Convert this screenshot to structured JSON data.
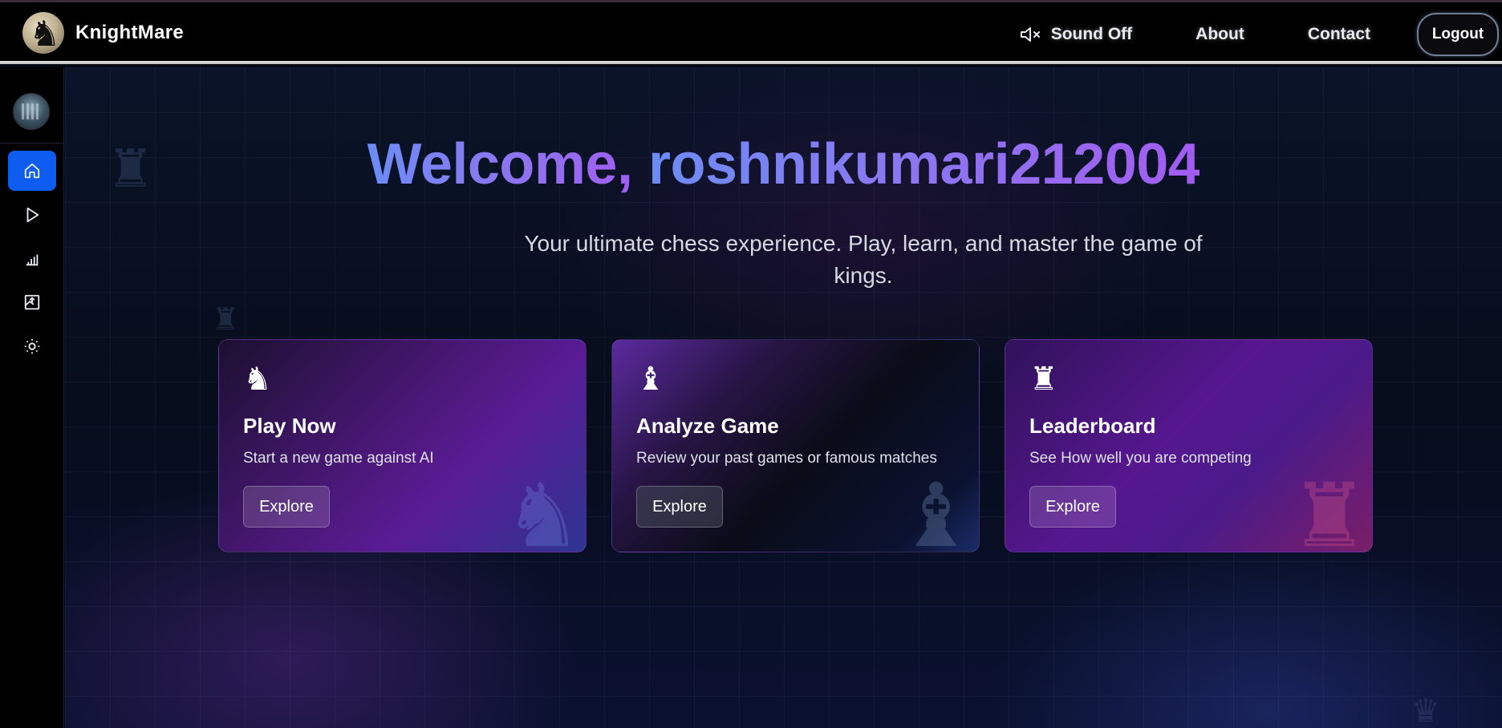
{
  "brand": {
    "name": "KnightMare",
    "logo_icon": "knight-icon"
  },
  "nav": {
    "sound_label": "Sound Off",
    "sound_icon": "speaker-muted-icon",
    "about_label": "About",
    "contact_label": "Contact",
    "logout_label": "Logout"
  },
  "sidebar": {
    "items": [
      {
        "icon": "home-icon",
        "active": true
      },
      {
        "icon": "play-icon",
        "active": false
      },
      {
        "icon": "bar-chart-icon",
        "active": false
      },
      {
        "icon": "image-upload-icon",
        "active": false
      },
      {
        "icon": "sun-icon",
        "active": false
      }
    ]
  },
  "main": {
    "welcome_prefix": "Welcome, ",
    "username": "roshnikumari212004",
    "subtitle": "Your ultimate chess experience. Play, learn, and master the game of kings.",
    "cards": [
      {
        "icon": "knight-icon",
        "glyph": "♞",
        "title": "Play Now",
        "description": "Start a new game against AI",
        "button": "Explore"
      },
      {
        "icon": "bishop-icon",
        "glyph": "♝",
        "title": "Analyze Game",
        "description": "Review your past games or famous matches",
        "button": "Explore"
      },
      {
        "icon": "rook-icon",
        "glyph": "♜",
        "title": "Leaderboard",
        "description": "See How well you are competing",
        "button": "Explore"
      }
    ]
  },
  "colors": {
    "accent_blue": "#0f5cf0",
    "heading_gradient_start": "#6c8cf5",
    "heading_gradient_end": "#a25cf0"
  }
}
